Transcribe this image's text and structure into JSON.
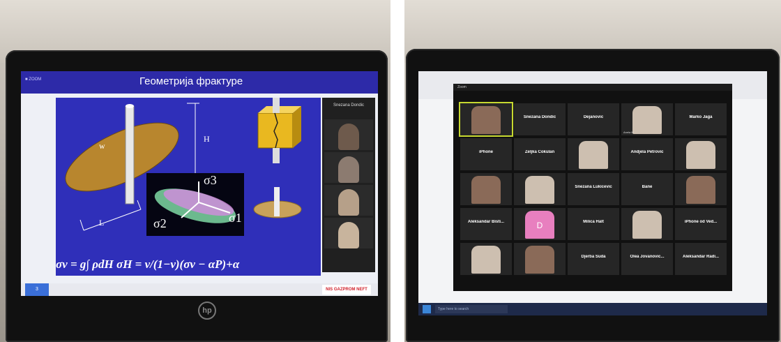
{
  "left_screen": {
    "slide_title": "Геометрија фрактуре",
    "header_small_text": "■ ZOOM",
    "label_w": "w",
    "label_H": "H",
    "label_L": "L",
    "sigma1": "σ1",
    "sigma2": "σ2",
    "sigma3": "σ3",
    "formula": "σv = g∫ ρdH   σH = ν/(1−ν)(σv − αP)+α",
    "page_number": "3",
    "footer_logo": "NIS GAZPROM NEFT",
    "side_panel_name": "Snezana Dondic"
  },
  "right_screen": {
    "zoom_title": "Zoom",
    "search_text": "Type here to search",
    "tiles": [
      {
        "name": "",
        "caption": "",
        "kind": "face",
        "active": true
      },
      {
        "name": "Snezana Dondic",
        "caption": "",
        "kind": "name"
      },
      {
        "name": "Dejanovic",
        "caption": "",
        "kind": "name"
      },
      {
        "name": "",
        "caption": "Anela M",
        "kind": "face-light"
      },
      {
        "name": "Marko Jaga",
        "caption": "",
        "kind": "name"
      },
      {
        "name": "iPhone",
        "caption": "",
        "kind": "name"
      },
      {
        "name": "Zeljka Čokulan",
        "caption": "",
        "kind": "name"
      },
      {
        "name": "",
        "caption": "",
        "kind": "face-light"
      },
      {
        "name": "Andjela Petrovic",
        "caption": "",
        "kind": "name"
      },
      {
        "name": "",
        "caption": "",
        "kind": "face-light"
      },
      {
        "name": "",
        "caption": "",
        "kind": "face"
      },
      {
        "name": "",
        "caption": "",
        "kind": "face-light"
      },
      {
        "name": "Snezana Lukicevic",
        "caption": "",
        "kind": "name"
      },
      {
        "name": "Bane",
        "caption": "",
        "kind": "name"
      },
      {
        "name": "",
        "caption": "",
        "kind": "face"
      },
      {
        "name": "Aleksandar Bisti...",
        "caption": "",
        "kind": "name"
      },
      {
        "name": "",
        "caption": "",
        "kind": "avatar",
        "letter": "D"
      },
      {
        "name": "Milica Halt",
        "caption": "",
        "kind": "name"
      },
      {
        "name": "",
        "caption": "",
        "kind": "face-light"
      },
      {
        "name": "iPhone od Ved...",
        "caption": "",
        "kind": "name"
      },
      {
        "name": "",
        "caption": "",
        "kind": "face-light"
      },
      {
        "name": "",
        "caption": "",
        "kind": "face"
      },
      {
        "name": "Djerba Suda",
        "caption": "",
        "kind": "name"
      },
      {
        "name": "Olea Jovanovic...",
        "caption": "",
        "kind": "name"
      },
      {
        "name": "Aleksandar Radi...",
        "caption": "",
        "kind": "name"
      }
    ]
  },
  "colors": {
    "slide_blue": "#2f2fb9",
    "zoom_dark": "#262626",
    "active_speaker": "#c7d930",
    "taskbar": "#1e2a4a"
  }
}
